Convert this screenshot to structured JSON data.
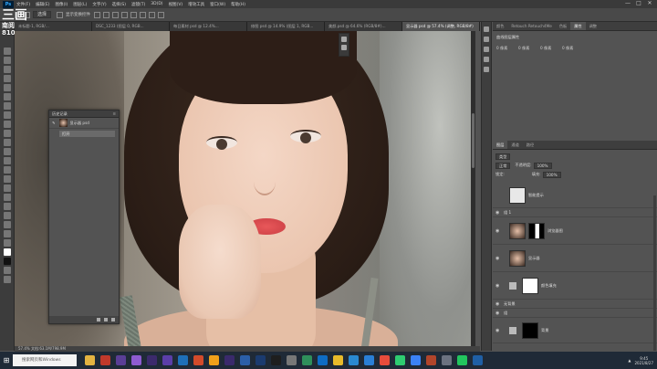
{
  "menubar": {
    "logo": "Ps",
    "items": [
      "文件(F)",
      "编辑(E)",
      "图像(I)",
      "图层(L)",
      "文字(Y)",
      "选择(S)",
      "滤镜(T)",
      "3D(D)",
      "视图(V)",
      "增效工具",
      "窗口(W)",
      "帮助(H)"
    ],
    "window_controls": [
      "—",
      "□",
      "✕"
    ]
  },
  "options": {
    "mode": "选择",
    "check_label": "显示变换控件"
  },
  "tabs": [
    {
      "label": "未标题-1, RGB/..."
    },
    {
      "label": "DSC_1233 (图层 0, RGB..."
    },
    {
      "label": "每日素材 psd @ 12.4%..."
    },
    {
      "label": "修图 psd @ 14.9% (图层 1, RGB..."
    },
    {
      "label": "美颜.psd @ 64.6% (RGB/8#)..."
    },
    {
      "label": "显示器 psd @ 57.4% (调整, RGB/8#)"
    }
  ],
  "canvas_tools": [
    "brush-tool",
    "move-tool"
  ],
  "status": "57.4%    文档:63.1M/798.9M",
  "history": {
    "title": "历史记录",
    "menu": "≡",
    "snapshot_label": "显示器 psd",
    "row": "打开"
  },
  "right": {
    "tabs": [
      "颜色",
      "Retouch Retouch4Me",
      "色板",
      "属性",
      "调整"
    ],
    "props_title": "曲线图层属性",
    "props_items": [
      "0 像素",
      "0 像素",
      "0 像素",
      "0 像素"
    ],
    "layer_tabs": [
      "图层",
      "通道",
      "路径"
    ],
    "kind": "类型",
    "blend": "正常",
    "opacity_label": "不透明度:",
    "opacity_value": "100%",
    "lock_label": "锁定:",
    "fill_label": "填充:",
    "fill_value": "100%",
    "layers": [
      {
        "name": "智能提示"
      },
      {
        "name": "组 1"
      },
      {
        "name": "浏览器图"
      },
      {
        "name": "显示器"
      },
      {
        "name": "颜色填充"
      },
      {
        "name": "无背景"
      },
      {
        "name": "组"
      },
      {
        "name": "背景"
      }
    ]
  },
  "taskbar": {
    "search_placeholder": "搜索网页和Windows",
    "time": "9:45",
    "date": "2021/8/27",
    "icons": [
      "folder",
      "music",
      "photo",
      "premiere",
      "after-effects",
      "audition",
      "photoshop",
      "chrome",
      "illustrator",
      "premiere2",
      "media-encoder",
      "lightroom",
      "davinci",
      "settings",
      "video",
      "mail",
      "note",
      "player",
      "browser",
      "weibo",
      "wechat",
      "browser2",
      "game",
      "app",
      "chat",
      "ps2"
    ]
  },
  "watermark": {
    "line1": "三画",
    "line2": "南阅号",
    "line3": "8108948"
  }
}
